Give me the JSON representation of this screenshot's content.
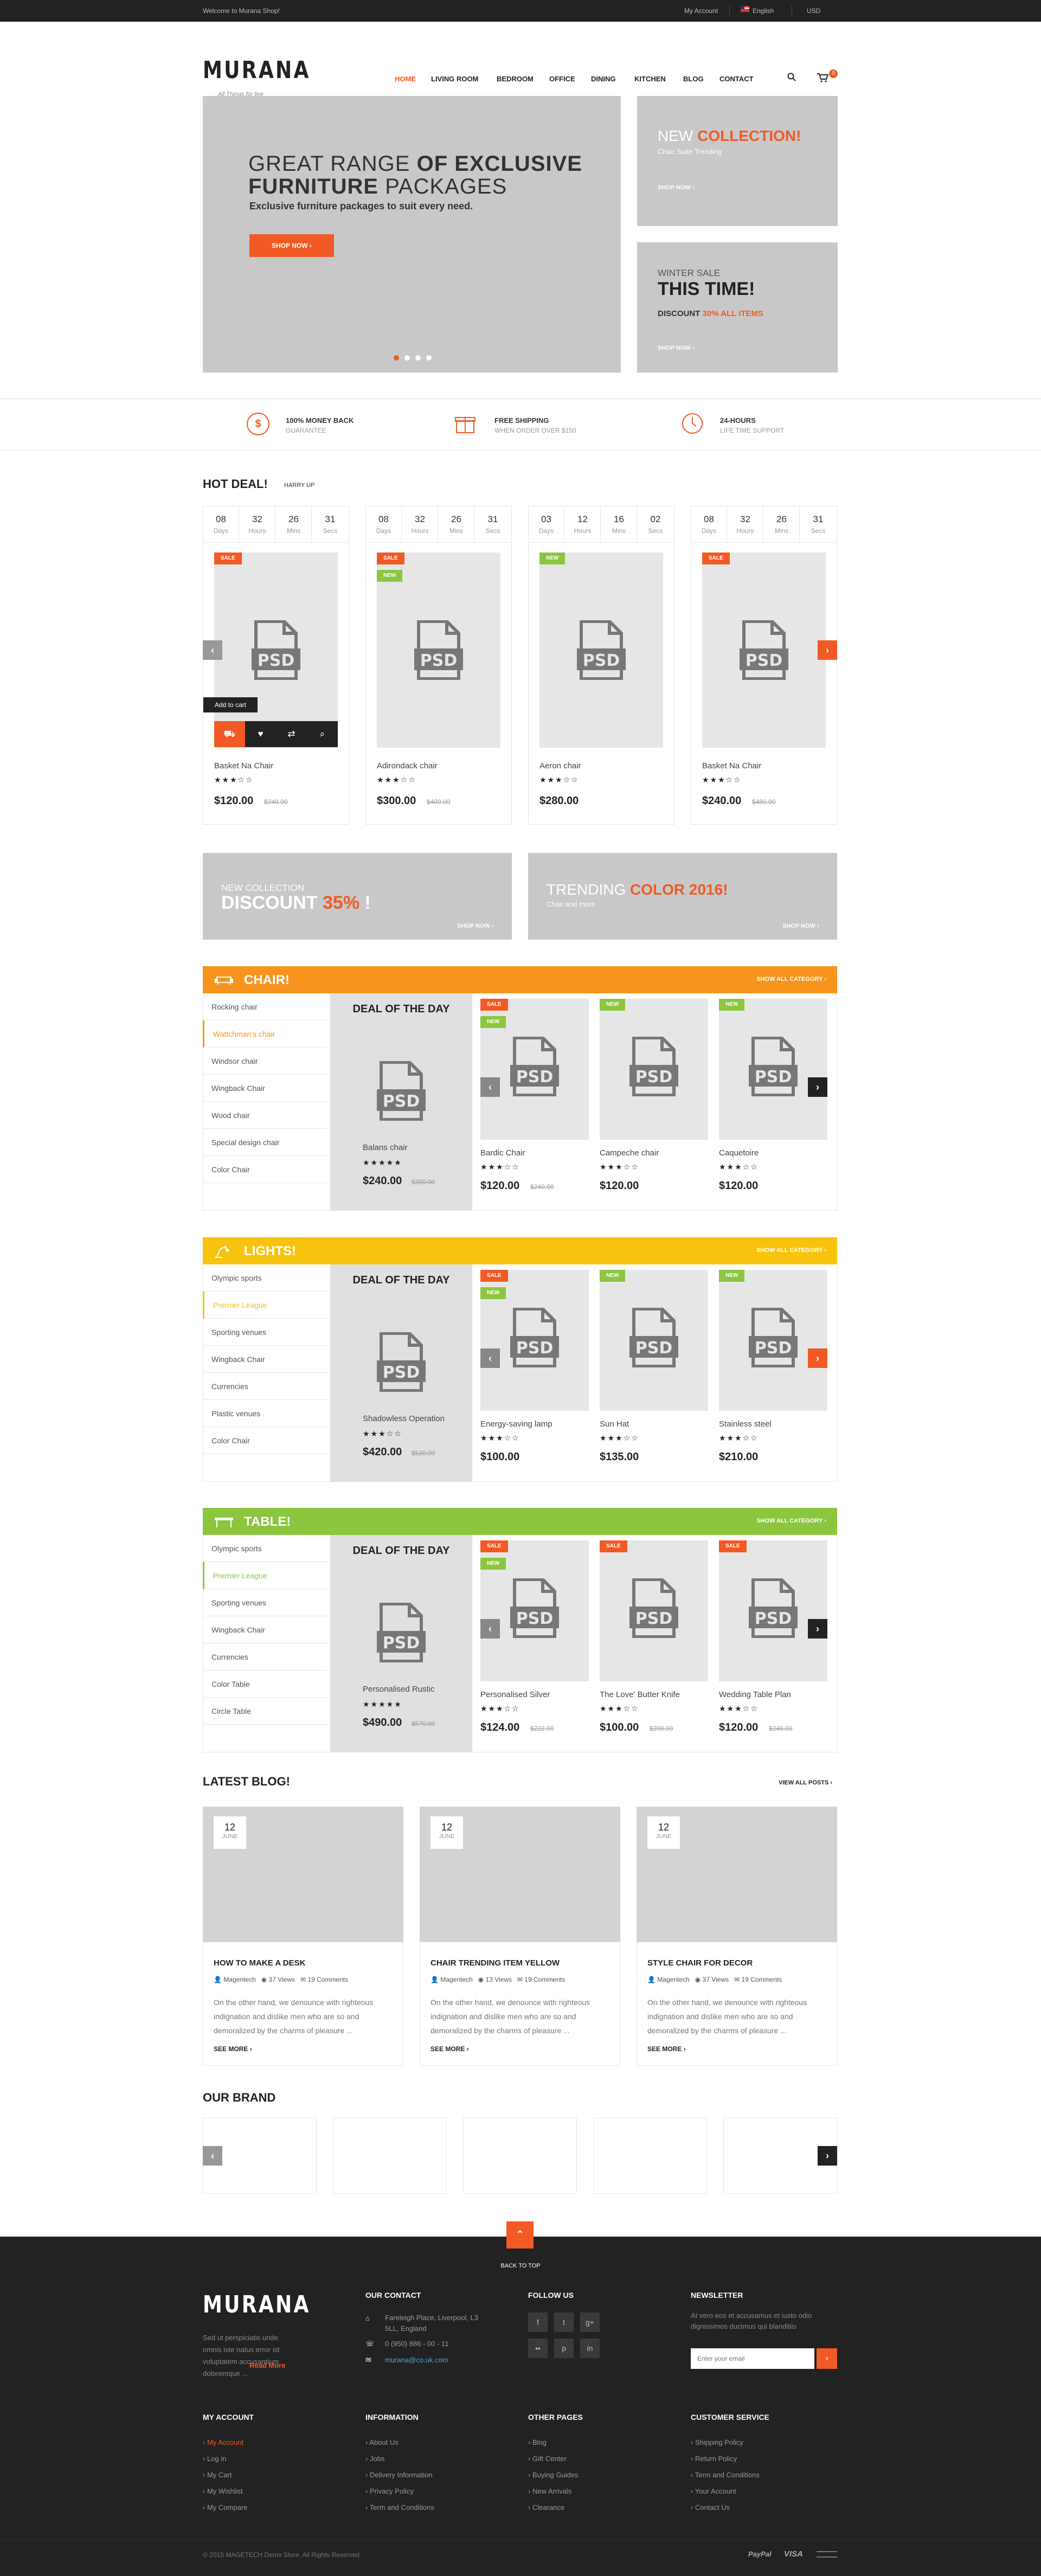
{
  "topbar": {
    "welcome": "Welcome to Murana Shop!",
    "account": "My Account",
    "language": "English",
    "currency": "USD"
  },
  "brand": {
    "logo": "MURANA",
    "tagline": "All Things for live"
  },
  "nav": [
    "HOME",
    "LIVING ROOM",
    "BEDROOM",
    "OFFICE",
    "DINING",
    "KITCHEN",
    "BLOG",
    "CONTACT"
  ],
  "cart": {
    "count": "0"
  },
  "hero": {
    "line1a": "GREAT RANGE",
    "line1b": "OF EXCLUSIVE",
    "line2a": "FURNITURE",
    "line2b": "PACKAGES",
    "sub": "Exclusive furniture packages to suit every need.",
    "button": "SHOP NOW"
  },
  "promo1": {
    "a": "NEW",
    "b": "COLLECTION!",
    "sub": "Chair Suite Trending",
    "btn": "SHOP NOW"
  },
  "promo2": {
    "a": "WINTER SALE",
    "b": "THIS TIME!",
    "c": "DISCOUNT",
    "d": "30%",
    "e": "ALL ITEMS",
    "btn": "SHOP NOW"
  },
  "services": [
    {
      "icon": "dollar-icon",
      "title": "100% MONEY BACK",
      "sub": "GUARANTEE"
    },
    {
      "icon": "gift-icon",
      "title": "FREE SHIPPING",
      "sub": "WHEN ORDER OVER $150"
    },
    {
      "icon": "clock-icon",
      "title": "24-HOURS",
      "sub": "LIFE TIME SUPPORT"
    }
  ],
  "hotdeal": {
    "title": "HOT DEAL!",
    "sub": "HARRY UP",
    "add_to_cart": "Add to cart",
    "units": [
      "Days",
      "Hours",
      "Mins",
      "Secs"
    ],
    "items": [
      {
        "count": [
          "08",
          "32",
          "26",
          "31"
        ],
        "name": "Basket Na Chair",
        "price": "$120.00",
        "old": "$240.00",
        "tags": [
          "SALE"
        ]
      },
      {
        "count": [
          "08",
          "32",
          "26",
          "31"
        ],
        "name": "Adirondack chair",
        "price": "$300.00",
        "old": "$400.00",
        "tags": [
          "SALE",
          "NEW"
        ]
      },
      {
        "count": [
          "03",
          "12",
          "16",
          "02"
        ],
        "name": "Aeron chair",
        "price": "$280.00",
        "old": "",
        "tags": [
          "NEW"
        ]
      },
      {
        "count": [
          "08",
          "32",
          "26",
          "31"
        ],
        "name": "Basket Na Chair",
        "price": "$240.00",
        "old": "$480.00",
        "tags": [
          "SALE"
        ]
      }
    ]
  },
  "banner1": {
    "a": "NEW COLLECTION",
    "b": "DISCOUNT",
    "c": "35%",
    "d": "!",
    "btn": "SHOP NOW"
  },
  "banner2": {
    "a": "TRENDING",
    "b": "COLOR 2016!",
    "sub": "Chair and more",
    "btn": "SHOP NOW"
  },
  "categories": [
    {
      "title": "CHAIR!",
      "color": "#f7941d",
      "showall": "SHOW ALL CATEGORY",
      "deal": "DEAL OF THE DAY",
      "side": [
        "Rocking chair",
        "Wattchman's chair",
        "Windsor chair",
        "Wingback Chair",
        "Wood chair",
        "Special design chair",
        "Color Chair"
      ],
      "dealitem": {
        "name": "Balans chair",
        "price": "$240.00",
        "old": "$300.00",
        "stars": "★★★★★"
      },
      "items": [
        {
          "name": "Bardic Chair",
          "price": "$120.00",
          "old": "$240.00",
          "tags": [
            "SALE",
            "NEW"
          ],
          "stars": "★★★☆☆"
        },
        {
          "name": "Campeche chair",
          "price": "$120.00",
          "old": "",
          "tags": [
            "NEW"
          ],
          "stars": "★★★☆☆"
        },
        {
          "name": "Caquetoire",
          "price": "$120.00",
          "old": "",
          "tags": [
            "NEW"
          ],
          "stars": "★★★☆☆"
        }
      ]
    },
    {
      "title": "LIGHTS!",
      "color": "#f8c30e",
      "showall": "SHOW ALL CATEGORY",
      "deal": "DEAL OF THE DAY",
      "side": [
        "Olympic sports",
        "Premier League",
        "Sporting venues",
        "Wingback Chair",
        "Currencies",
        "Plastic venues",
        "Color Chair"
      ],
      "dealitem": {
        "name": "Shadowless Operation",
        "price": "$420.00",
        "old": "$520.00",
        "stars": "★★★☆☆"
      },
      "items": [
        {
          "name": "Energy-saving lamp",
          "price": "$100.00",
          "old": "",
          "tags": [
            "SALE",
            "NEW"
          ],
          "stars": "★★★☆☆"
        },
        {
          "name": "Sun Hat",
          "price": "$135.00",
          "old": "",
          "tags": [
            "NEW"
          ],
          "stars": "★★★☆☆"
        },
        {
          "name": "Stainless steel",
          "price": "$210.00",
          "old": "",
          "tags": [
            "NEW"
          ],
          "stars": "★★★☆☆"
        }
      ]
    },
    {
      "title": "TABLE!",
      "color": "#8cc63f",
      "showall": "SHOW ALL CATEGORY",
      "deal": "DEAL OF THE DAY",
      "side": [
        "Olympic sports",
        "Premier League",
        "Sporting venues",
        "Wingback Chair",
        "Currencies",
        "Color Table",
        "Circle Table"
      ],
      "dealitem": {
        "name": "Personalised Rustic",
        "price": "$490.00",
        "old": "$570.00",
        "stars": "★★★★★"
      },
      "items": [
        {
          "name": "Personalised Silver",
          "price": "$124.00",
          "old": "$222.00",
          "tags": [
            "SALE",
            "NEW"
          ],
          "stars": "★★★☆☆"
        },
        {
          "name": "The Love' Butter Knife",
          "price": "$100.00",
          "old": "$200.00",
          "tags": [
            "SALE"
          ],
          "stars": "★★★☆☆"
        },
        {
          "name": "Wedding Table Plan",
          "price": "$120.00",
          "old": "$240.00",
          "tags": [
            "SALE"
          ],
          "stars": "★★★☆☆"
        }
      ]
    }
  ],
  "blog": {
    "title": "LATEST BLOG!",
    "viewall": "VIEW ALL POSTS",
    "readmore": "SEE MORE",
    "excerpt": "On the other hand, we denounce with righteous indignation and dislike men who are so and demoralized by the charms of pleasure ...",
    "posts": [
      {
        "day": "12",
        "month": "JUNE",
        "title": "HOW TO MAKE A DESK",
        "author": "Magentech",
        "views": "37 Views",
        "comments": "19 Comments"
      },
      {
        "day": "12",
        "month": "JUNE",
        "title": "CHAIR TRENDING ITEM YELLOW",
        "author": "Magentech",
        "views": "13 Views",
        "comments": "19 Comments"
      },
      {
        "day": "12",
        "month": "JUNE",
        "title": "STYLE CHAIR FOR DECOR",
        "author": "Magentech",
        "views": "37 Views",
        "comments": "19 Comments"
      }
    ]
  },
  "brands": {
    "title": "OUR BRAND"
  },
  "backtotop": "BACK TO TOP",
  "footer": {
    "about": "Sed ut perspiciatis unde omnis iste natus error sit voluptatem accusantium doloremque ...",
    "readmore": "Read More",
    "contact_title": "OUR CONTACT",
    "address": "Fareleigh Place, Liverpool, L3 5LL, England",
    "phone": "0 (950) 886 - 00 - 11",
    "email": "murana@co.uk.com",
    "follow_title": "FOLLOW US",
    "newsletter_title": "NEWSLETTER",
    "newsletter_text": "At vero eos et accusamus et iusto odio dignissimos ducimus qui blanditiis",
    "newsletter_placeholder": "Enter your email",
    "cols": [
      {
        "title": "MY ACCOUNT",
        "links": [
          "My Account",
          "Log in",
          "My Cart",
          "My Wishlist",
          "My Compare"
        ]
      },
      {
        "title": "INFORMATION",
        "links": [
          "About Us",
          "Jobs",
          "Delivery Information",
          "Privacy Policy",
          "Term and Conditions"
        ]
      },
      {
        "title": "OTHER PAGES",
        "links": [
          "Blog",
          "Gift Center",
          "Buying Guides",
          "New Arrivals",
          "Clearance"
        ]
      },
      {
        "title": "CUSTOMER SERVICE",
        "links": [
          "Shipping Policy",
          "Return Policy",
          "Term and Conditions",
          "Your Account",
          "Contact Us"
        ]
      }
    ],
    "copyright": "© 2015 MAGETECH Demo Store. All Rights Reserved.",
    "payments": [
      "PayPal",
      "VISA"
    ]
  }
}
